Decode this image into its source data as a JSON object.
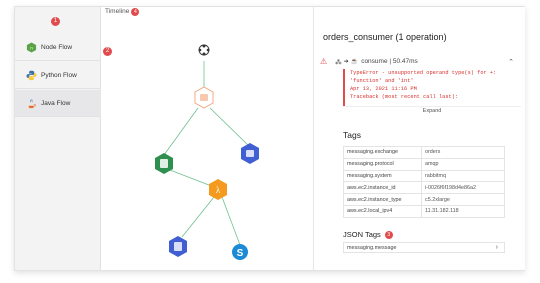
{
  "sidebar": {
    "badge": "1",
    "items": [
      {
        "label": "Node Flow",
        "icon": "nodejs-icon"
      },
      {
        "label": "Python Flow",
        "icon": "python-icon"
      },
      {
        "label": "Java Flow",
        "icon": "java-icon"
      }
    ]
  },
  "canvas": {
    "timeline_label": "Timeline",
    "timeline_badge": "4",
    "badge2": "2"
  },
  "panel": {
    "title": "orders_consumer (1 operation)",
    "error_row": "consume | 50.47ms",
    "error_lines": [
      "TypeError - unsupported operand type(s) for +:",
      "'function' and 'int'",
      "Apr 13, 2021 11:16 PM",
      "Traceback (most recent call last):"
    ],
    "expand_label": "Expand",
    "tags_title": "Tags",
    "tags": [
      {
        "key": "messaging.exchange",
        "value": "orders"
      },
      {
        "key": "messaging.protocol",
        "value": "amqp"
      },
      {
        "key": "messaging.system",
        "value": "rabbitmq"
      },
      {
        "key": "aws.ec2.instance_id",
        "value": "i-0026f6f198d4e86a2"
      },
      {
        "key": "aws.ec2.instance_type",
        "value": "c5.2xlarge"
      },
      {
        "key": "aws.ec2.local_ipv4",
        "value": "11.31.182.118"
      }
    ],
    "json_tags_title": "JSON Tags",
    "json_badge": "3",
    "json_tags": [
      {
        "key": "messaging.message"
      }
    ]
  },
  "colors": {
    "accent_red": "#e24b4b",
    "edge_green": "#6cc08f",
    "java_orange": "#f0a37a",
    "aws_green": "#2f8f4e",
    "aws_blue": "#3f5fd2",
    "lambda_orange": "#f39a1f",
    "sns_blue": "#1c8bd6"
  }
}
